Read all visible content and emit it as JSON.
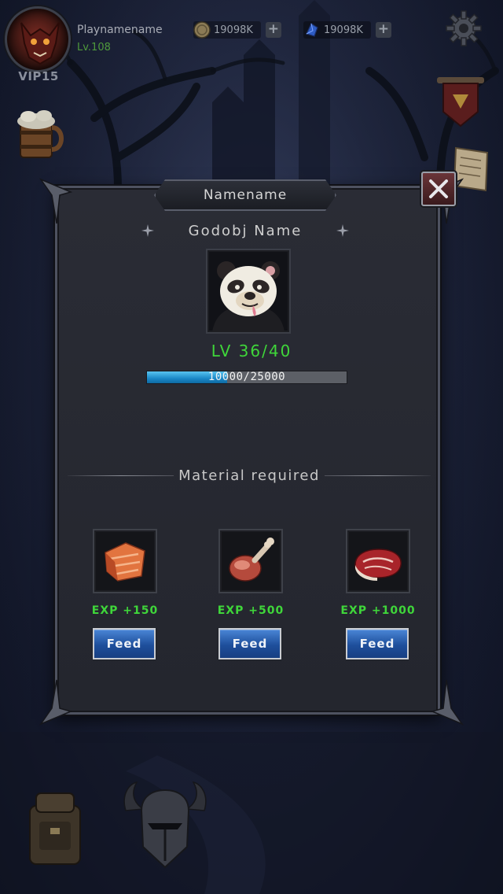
{
  "hud": {
    "player_name": "Playnamename",
    "player_level": "Lv.108",
    "vip": "VIP15",
    "coins": "19098K",
    "gems": "19098K",
    "plus_label": "+",
    "icons": [
      "avatar-demon-icon",
      "coin-icon",
      "crystal-icon",
      "gear-icon",
      "beer-mug-icon",
      "banner-icon",
      "scroll-icon",
      "backpack-icon",
      "helmet-icon"
    ]
  },
  "dialog": {
    "title": "Namename",
    "close_icon": "close-icon",
    "pet_name": "Godobj Name",
    "level": "LV 36/40",
    "exp_text": "10000/25000",
    "exp_fraction": 0.4,
    "material_header": "Material required",
    "items": [
      {
        "icon": "salmon-icon",
        "exp": "EXP +150",
        "button": "Feed"
      },
      {
        "icon": "drumstick-icon",
        "exp": "EXP +500",
        "button": "Feed"
      },
      {
        "icon": "steak-icon",
        "exp": "EXP +1000",
        "button": "Feed"
      }
    ]
  },
  "colors": {
    "exp_green": "#3fd63a",
    "button_blue": "#1e4f9c",
    "level_green": "#4f9a3c"
  }
}
